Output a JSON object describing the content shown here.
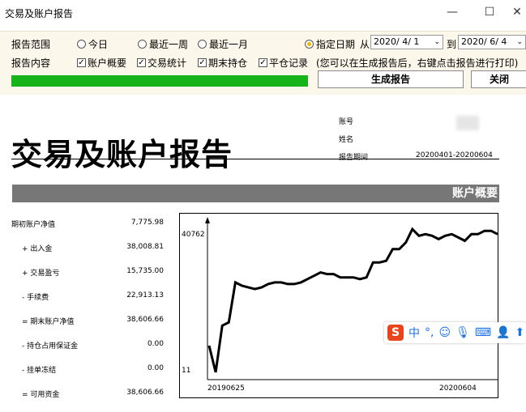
{
  "window": {
    "title": "交易及账户报告",
    "minimize": "—",
    "maximize": "☐",
    "close": "✕"
  },
  "options": {
    "range_label": "报告范围",
    "content_label": "报告内容",
    "ranges": [
      "今日",
      "最近一周",
      "最近一月",
      "指定日期"
    ],
    "selected_range": "指定日期",
    "from_label": "从",
    "to_label": "到",
    "from_date": "2020/ 4/ 1",
    "to_date": "2020/ 6/ 4",
    "contents": [
      "账户概要",
      "交易统计",
      "期末持仓",
      "平仓记录"
    ],
    "hint": "(您可以在生成报告后，右键点击报告进行打印)",
    "progress": 1.0,
    "generate_button": "生成报告",
    "close_button": "关闭"
  },
  "report": {
    "title": "交易及账户报告",
    "account_label": "账号",
    "name_label": "姓名",
    "period_label": "报告期间",
    "period_value": "20200401-20200604",
    "section_title": "账户概要",
    "summary": [
      {
        "label": "期初账户净值",
        "value": "7,775.98"
      },
      {
        "label": "+ 出入金",
        "value": "38,008.81"
      },
      {
        "label": "+ 交易盈亏",
        "value": "15,735.00"
      },
      {
        "label": "- 手续费",
        "value": "22,913.13"
      },
      {
        "label": "= 期末账户净值",
        "value": "38,606.66"
      },
      {
        "label": "- 持仓占用保证金",
        "value": "0.00"
      },
      {
        "label": "- 挂单冻结",
        "value": "0.00"
      },
      {
        "label": "= 可用资金",
        "value": "38,606.66"
      }
    ]
  },
  "chart_data": {
    "type": "line",
    "x_start_label": "20190625",
    "x_end_label": "20200604",
    "y_max_label": "40762",
    "y_min_label": "11",
    "ylim": [
      11,
      40762
    ],
    "values": [
      9000,
      1000,
      15000,
      16000,
      28000,
      27000,
      26500,
      26000,
      26500,
      27500,
      28000,
      28000,
      27500,
      27500,
      28000,
      29000,
      30000,
      31000,
      30500,
      30500,
      29500,
      29500,
      29500,
      29000,
      29500,
      34000,
      34000,
      34500,
      38000,
      38000,
      40000,
      44000,
      42000,
      42500,
      42000,
      41000,
      42000,
      42500,
      41500,
      40500,
      42500,
      42500,
      43500,
      43500,
      42500
    ]
  },
  "ime": {
    "logo": "S",
    "lang": "中",
    "punct": "°,",
    "icons": [
      "emoji-icon",
      "mic-icon",
      "keyboard-icon",
      "user-icon",
      "up-icon"
    ]
  }
}
